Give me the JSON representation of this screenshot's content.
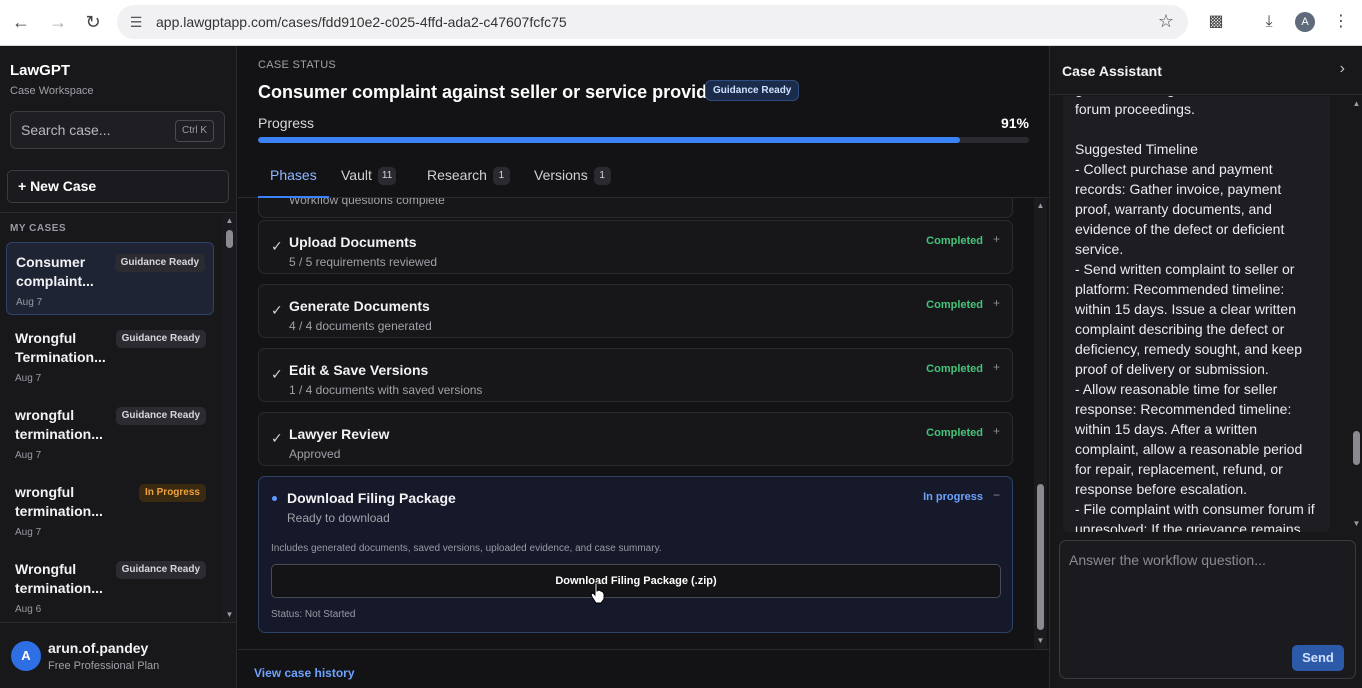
{
  "browser": {
    "url": "app.lawgptapp.com/cases/fdd910e2-c025-4ffd-ada2-c47607fcfc75",
    "profile_initial": "A"
  },
  "sidebar": {
    "brand": "LawGPT",
    "brand_sub": "Case Workspace",
    "search_placeholder": "Search case...",
    "search_shortcut": "Ctrl K",
    "new_case_label": "+ New Case",
    "section_label": "MY CASES",
    "cases": [
      {
        "title": "Consumer complaint...",
        "badge": "Guidance Ready",
        "date": "Aug 7",
        "active": true
      },
      {
        "title": "Wrongful Termination...",
        "badge": "Guidance Ready",
        "date": "Aug 7"
      },
      {
        "title": "wrongful termination...",
        "badge": "Guidance Ready",
        "date": "Aug 7"
      },
      {
        "title": "wrongful termination...",
        "badge": "In Progress",
        "date": "Aug 7"
      },
      {
        "title": "Wrongful termination...",
        "badge": "Guidance Ready",
        "date": "Aug 6"
      }
    ],
    "user": {
      "initial": "A",
      "name": "arun.of.pandey",
      "plan": "Free Professional Plan"
    }
  },
  "main": {
    "status_label": "CASE STATUS",
    "title": "Consumer complaint against seller or service provider",
    "title_badge": "Guidance Ready",
    "progress_label": "Progress",
    "progress_pct": "91%",
    "progress_value": 0.91,
    "tabs": [
      {
        "label": "Phases",
        "count": ""
      },
      {
        "label": "Vault",
        "count": "11"
      },
      {
        "label": "Research",
        "count": "1"
      },
      {
        "label": "Versions",
        "count": "1"
      }
    ],
    "phases": [
      {
        "title": "Upload Documents",
        "sub": "5 / 5 requirements reviewed",
        "status": "Completed",
        "icon": "check",
        "toggle": "+"
      },
      {
        "title": "Generate Documents",
        "sub": "4 / 4 documents generated",
        "status": "Completed",
        "icon": "check",
        "toggle": "+"
      },
      {
        "title": "Edit & Save Versions",
        "sub": "1 / 4 documents with saved versions",
        "status": "Completed",
        "icon": "check",
        "toggle": "+"
      },
      {
        "title": "Lawyer Review",
        "sub": "Approved",
        "status": "Completed",
        "icon": "check",
        "toggle": "+"
      },
      {
        "title": "Download Filing Package",
        "sub": "Ready to download",
        "status": "In progress",
        "icon": "dot",
        "toggle": "−",
        "desc": "Includes generated documents, saved versions, uploaded evidence, and case summary.",
        "button": "Download Filing Package (.zip)",
        "status_note": "Status: Not Started"
      }
    ],
    "partial_phase_text": "Workflow questions complete",
    "history_link": "View case history"
  },
  "assistant": {
    "title": "Case Assistant",
    "message": "guidance during\nforum proceedings.\n\nSuggested Timeline\n- Collect purchase and payment records: Gather invoice, payment proof, warranty documents, and evidence of the defect or deficient service.\n- Send written complaint to seller or platform: Recommended timeline: within 15 days. Issue a clear written complaint describing the defect or deficiency, remedy sought, and keep proof of delivery or submission.\n- Allow reasonable time for seller response: Recommended timeline: within 15 days. After a written complaint, allow a reasonable period for repair, replacement, refund, or response before escalation.\n- File complaint with consumer forum if unresolved: If the grievance remains",
    "input_placeholder": "Answer the workflow question...",
    "send_label": "Send"
  }
}
